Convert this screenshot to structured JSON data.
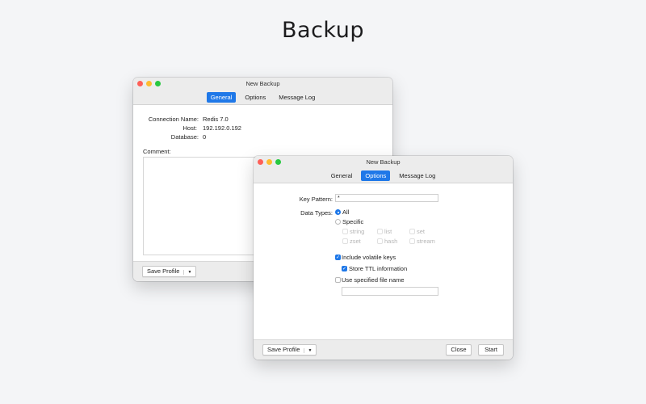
{
  "page_title": "Backup",
  "back_window": {
    "title": "New Backup",
    "tabs": [
      "General",
      "Options",
      "Message Log"
    ],
    "active_tab": "General",
    "fields": {
      "connection_name_label": "Connection Name:",
      "connection_name_value": "Redis 7.0",
      "host_label": "Host:",
      "host_value": "192.192.0.192",
      "database_label": "Database:",
      "database_value": "0",
      "comment_label": "Comment:"
    },
    "save_profile_label": "Save Profile",
    "caret_glyph": "▼"
  },
  "front_window": {
    "title": "New Backup",
    "tabs": [
      "General",
      "Options",
      "Message Log"
    ],
    "active_tab": "Options",
    "key_pattern_label": "Key Pattern:",
    "key_pattern_value": "*",
    "data_types_label": "Data Types:",
    "data_type_all_label": "All",
    "data_type_specific_label": "Specific",
    "specific_types": [
      "string",
      "list",
      "set",
      "zset",
      "hash",
      "stream"
    ],
    "include_volatile_label": "Include volatile keys",
    "store_ttl_label": "Store TTL information",
    "use_file_name_label": "Use specified file name",
    "file_name_value": "",
    "save_profile_label": "Save Profile",
    "caret_glyph": "▼",
    "close_label": "Close",
    "start_label": "Start",
    "check_glyph": "✓"
  },
  "colors": {
    "accent": "#1f78e8",
    "close_light": "#fe5f57",
    "minimize_light": "#febc2e",
    "zoom_light": "#28c840"
  }
}
